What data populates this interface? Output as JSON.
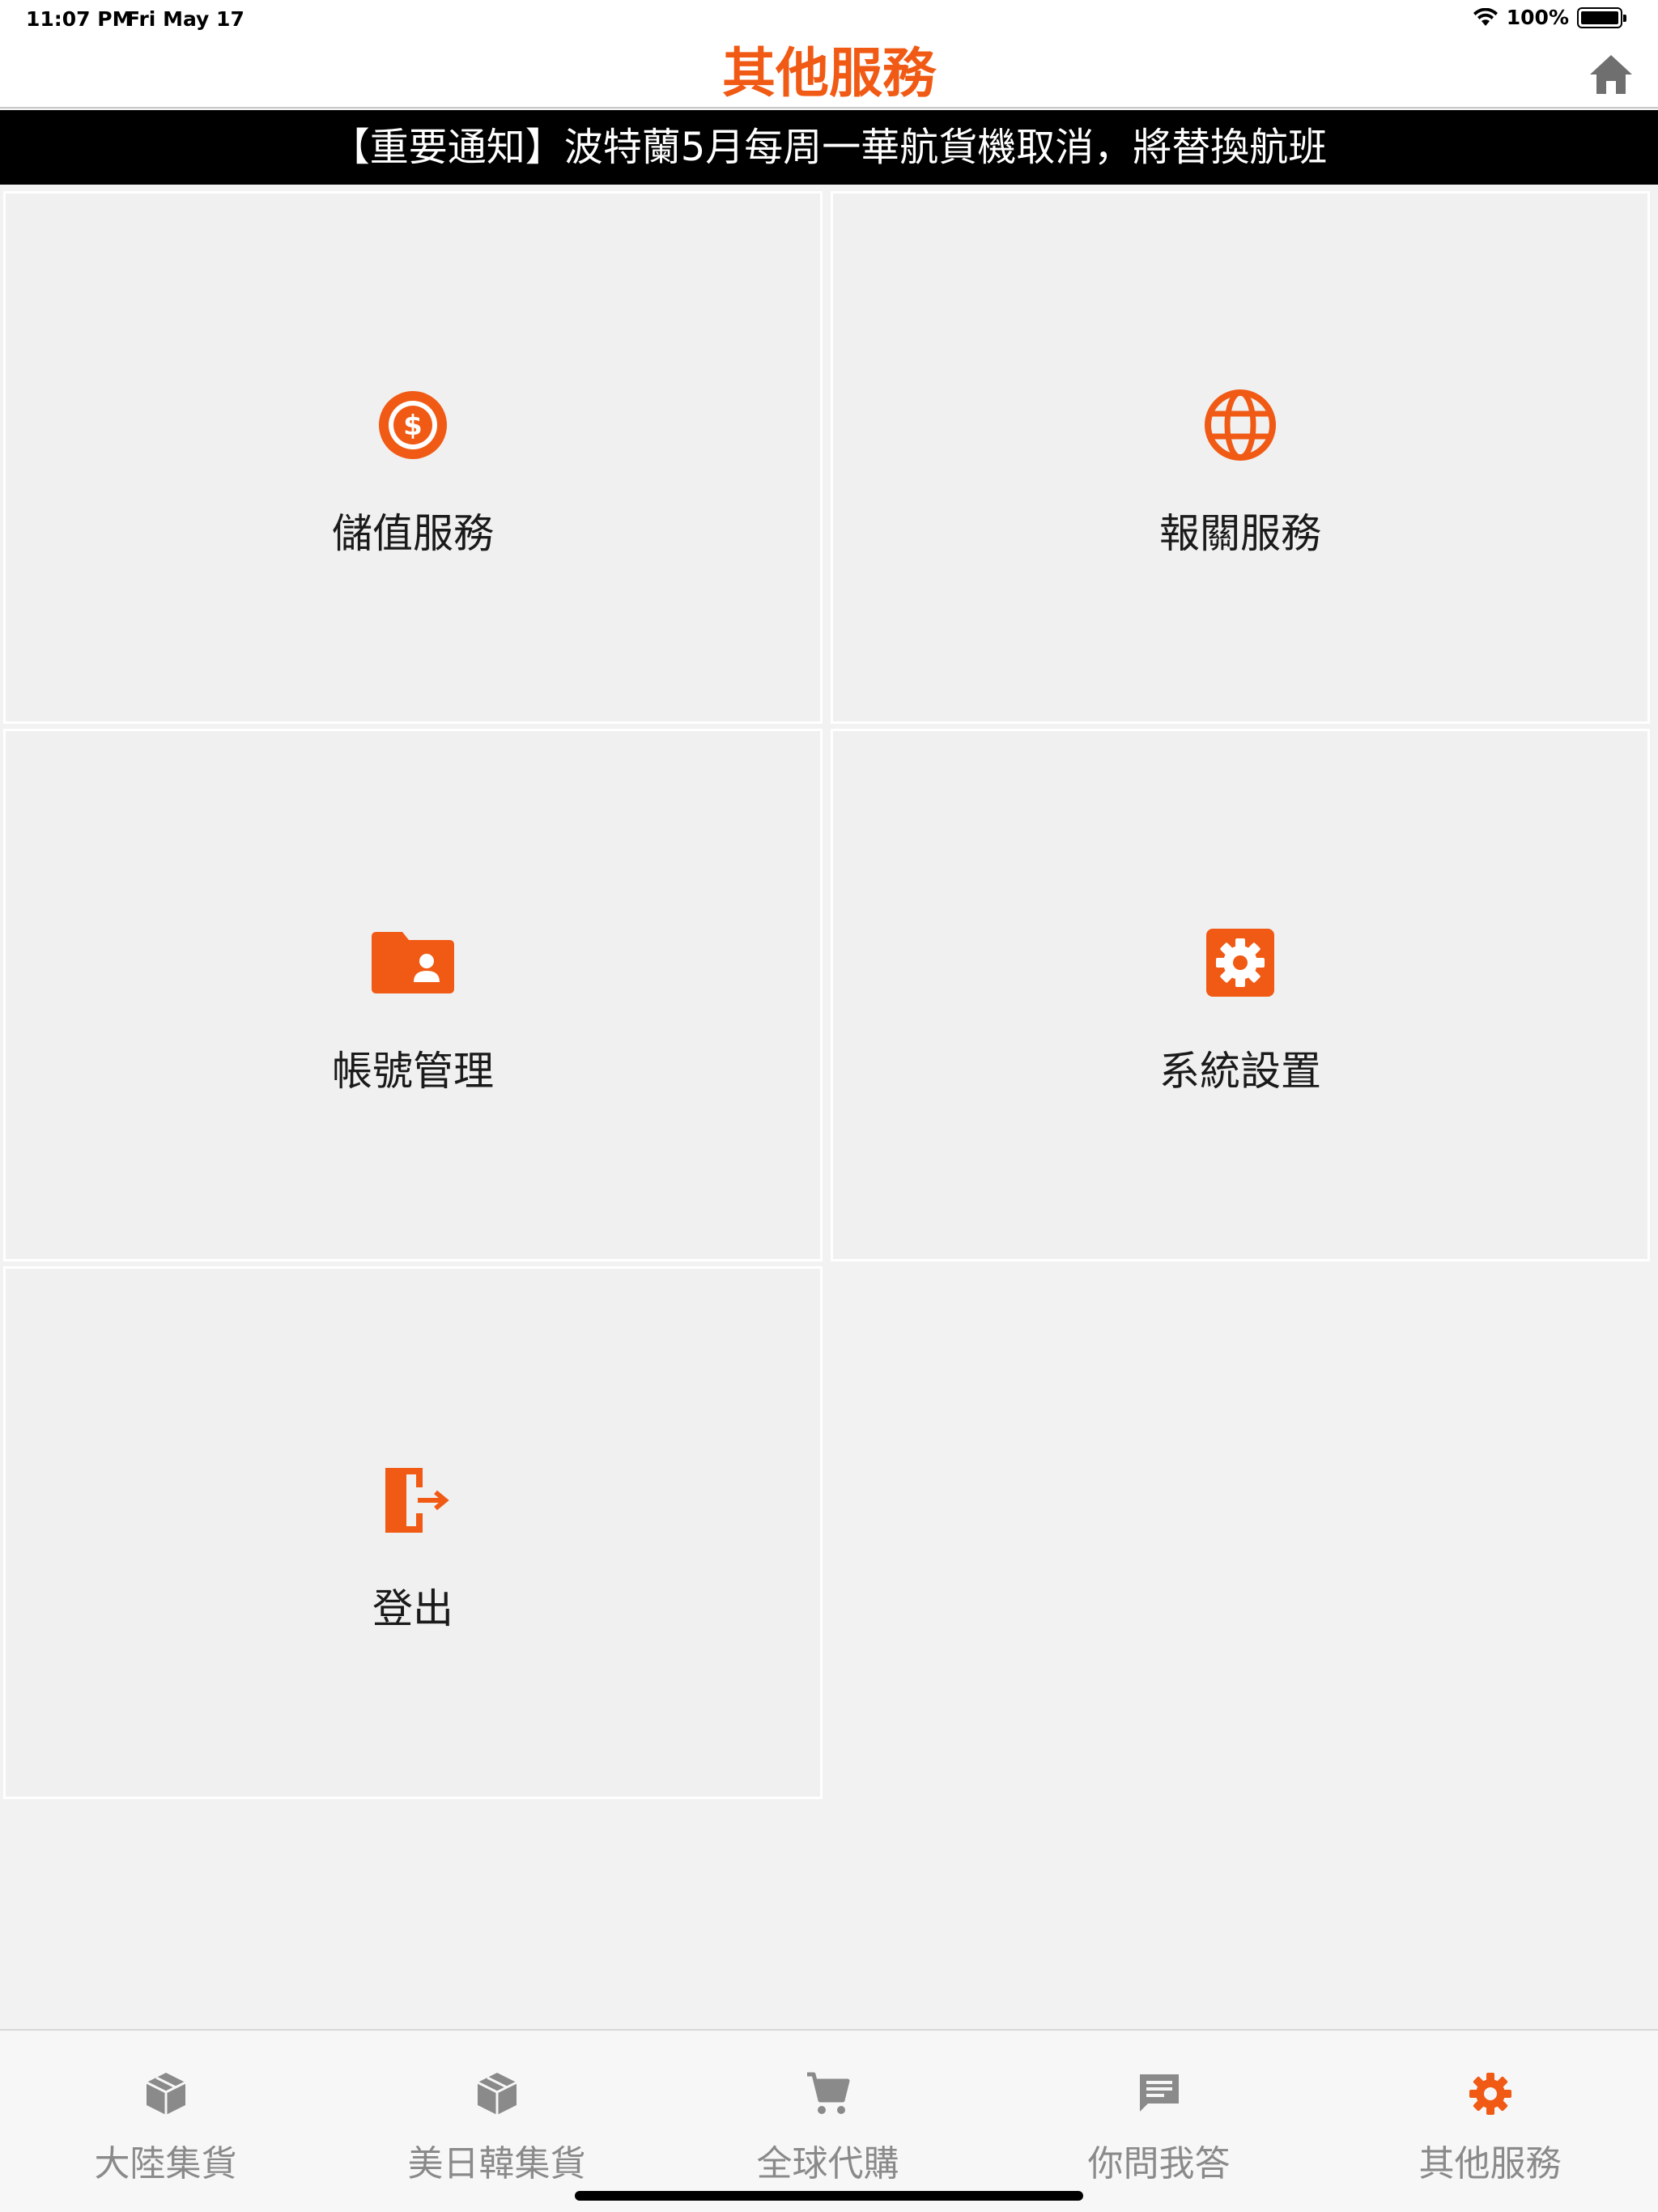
{
  "status_bar": {
    "time": "11:07 PM",
    "date": "Fri May 17",
    "battery": "100%"
  },
  "header": {
    "title": "其他服務"
  },
  "notice": {
    "text": "【重要通知】波特蘭5月每周一華航貨機取消，將替換航班"
  },
  "tiles": [
    {
      "label": "儲值服務",
      "icon": "dollar-circle-icon"
    },
    {
      "label": "報關服務",
      "icon": "globe-icon"
    },
    {
      "label": "帳號管理",
      "icon": "account-folder-icon"
    },
    {
      "label": "系統設置",
      "icon": "settings-gear-icon"
    },
    {
      "label": "登出",
      "icon": "logout-door-icon"
    }
  ],
  "tabs": [
    {
      "label": "大陸集貨",
      "icon": "package-icon"
    },
    {
      "label": "美日韓集貨",
      "icon": "package-icon"
    },
    {
      "label": "全球代購",
      "icon": "cart-icon"
    },
    {
      "label": "你問我答",
      "icon": "chat-icon"
    },
    {
      "label": "其他服務",
      "icon": "gear-icon",
      "active": true
    }
  ],
  "colors": {
    "accent": "#f05a14",
    "inactive": "#8a8a8a",
    "notice_bg": "#000000"
  }
}
